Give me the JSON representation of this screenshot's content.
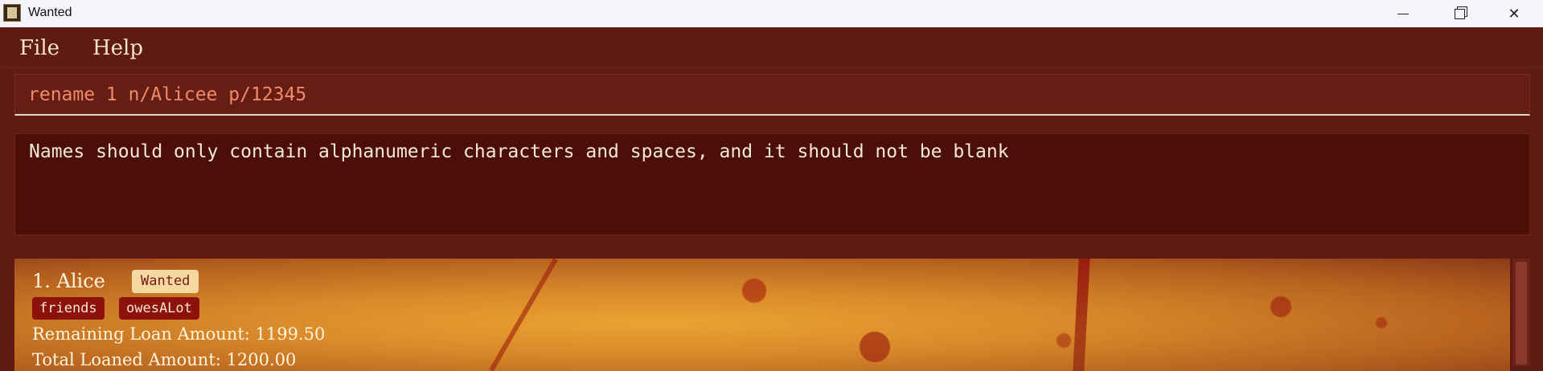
{
  "window": {
    "title": "Wanted",
    "minimize_icon": "minimize-icon",
    "maximize_icon": "restore-icon",
    "close_icon": "close-icon",
    "close_label": "✕"
  },
  "menu": {
    "items": [
      {
        "label": "File"
      },
      {
        "label": "Help"
      }
    ]
  },
  "command": {
    "value": "rename 1 n/Alicee p/12345"
  },
  "result": {
    "message": "Names should only contain alphanumeric characters and spaces, and it should not be blank"
  },
  "list": {
    "persons": [
      {
        "index_name": "1. Alice",
        "status": "Wanted",
        "tags": [
          "friends",
          "owesALot"
        ],
        "remaining": "Remaining Loan Amount: 1199.50",
        "total": "Total Loaned Amount: 1200.00"
      }
    ]
  },
  "colors": {
    "background": "#5e1a13",
    "result_bg": "#4b0f08",
    "command_text": "#f08a6a",
    "tag_bg": "#8c120b",
    "wanted_badge_bg": "#f5d9a0"
  }
}
